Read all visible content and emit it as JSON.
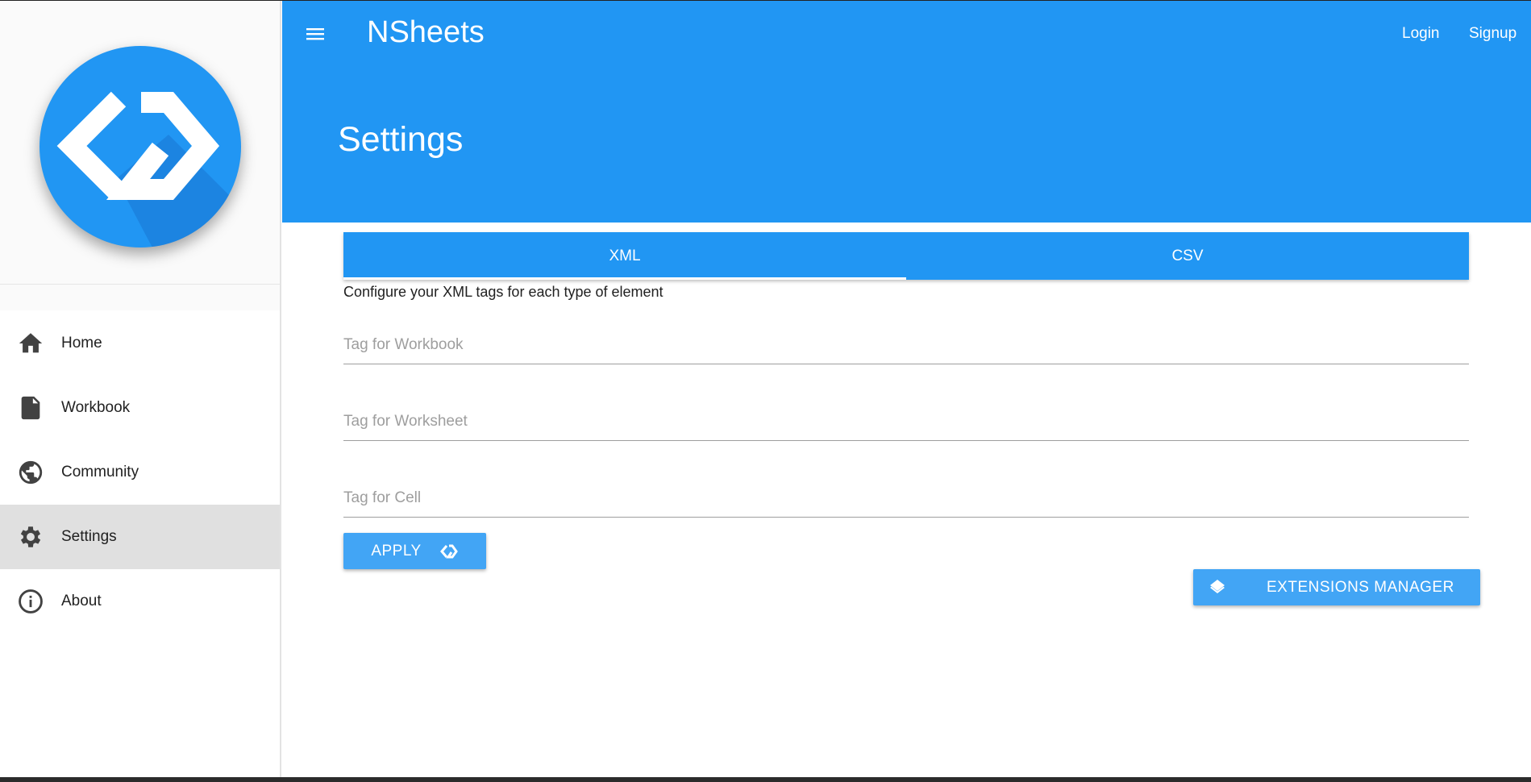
{
  "app": {
    "title": "NSheets",
    "login_label": "Login",
    "signup_label": "Signup",
    "accent_color": "#2196f3"
  },
  "page": {
    "title": "Settings"
  },
  "sidebar": {
    "items": [
      {
        "label": "Home",
        "icon": "home-icon"
      },
      {
        "label": "Workbook",
        "icon": "file-icon"
      },
      {
        "label": "Community",
        "icon": "globe-icon"
      },
      {
        "label": "Settings",
        "icon": "gear-icon",
        "active": true
      },
      {
        "label": "About",
        "icon": "info-icon"
      }
    ]
  },
  "tabs": [
    {
      "label": "XML",
      "active": true
    },
    {
      "label": "CSV",
      "active": false
    }
  ],
  "xml_settings": {
    "description": "Configure your XML tags for each type of element",
    "workbook_placeholder": "Tag for Workbook",
    "worksheet_placeholder": "Tag for Worksheet",
    "cell_placeholder": "Tag for Cell",
    "apply_label": "APPLY"
  },
  "extensions": {
    "label": "EXTENSIONS MANAGER",
    "icon": "layers-icon"
  }
}
